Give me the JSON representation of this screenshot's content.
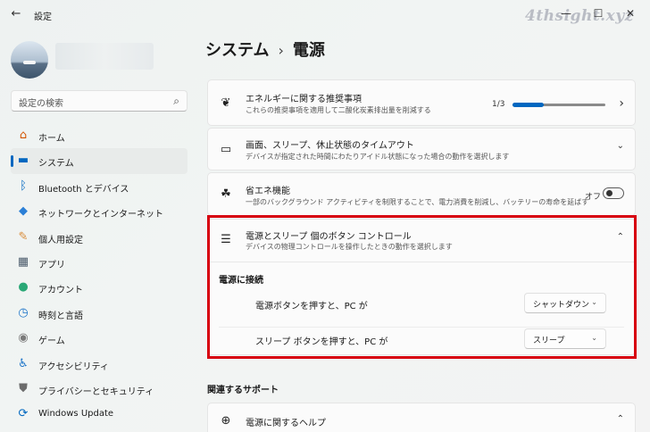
{
  "window": {
    "title": "設定",
    "back_glyph": "←",
    "minimize_glyph": "—",
    "maximize_glyph": "☐",
    "close_glyph": "✕",
    "watermark": "4thsight.xyz"
  },
  "search": {
    "placeholder": "設定の検索",
    "icon": "⌕"
  },
  "sidebar": {
    "items": [
      {
        "label": "ホーム",
        "icon": "home-icon",
        "glyph": "⌂",
        "color": "#d35400"
      },
      {
        "label": "システム",
        "icon": "system-icon",
        "glyph": "▬",
        "color": "#0067c0",
        "active": true
      },
      {
        "label": "Bluetooth とデバイス",
        "icon": "bluetooth-icon",
        "glyph": "ᛒ",
        "color": "#0067c0"
      },
      {
        "label": "ネットワークとインターネット",
        "icon": "network-icon",
        "glyph": "◆",
        "color": "#2b7fd6"
      },
      {
        "label": "個人用設定",
        "icon": "brush-icon",
        "glyph": "✎",
        "color": "#d98c3a"
      },
      {
        "label": "アプリ",
        "icon": "apps-icon",
        "glyph": "▦",
        "color": "#4a5a6a"
      },
      {
        "label": "アカウント",
        "icon": "account-icon",
        "glyph": "●",
        "color": "#2aa876"
      },
      {
        "label": "時刻と言語",
        "icon": "time-language-icon",
        "glyph": "◷",
        "color": "#1a73c8"
      },
      {
        "label": "ゲーム",
        "icon": "game-icon",
        "glyph": "◉",
        "color": "#7a7a7a"
      },
      {
        "label": "アクセシビリティ",
        "icon": "accessibility-icon",
        "glyph": "♿",
        "color": "#1a73c8"
      },
      {
        "label": "プライバシーとセキュリティ",
        "icon": "shield-icon",
        "glyph": "⛊",
        "color": "#6b6b6b"
      },
      {
        "label": "Windows Update",
        "icon": "windows-update-icon",
        "glyph": "⟳",
        "color": "#0067c0"
      }
    ]
  },
  "breadcrumb": {
    "parent": "システム",
    "separator": "›",
    "current": "電源"
  },
  "cards": {
    "energy_recommendations": {
      "icon": "leaf-icon",
      "glyph": "❦",
      "title": "エネルギーに関する推奨事項",
      "subtitle": "これらの推奨事項を適用して二酸化炭素排出量を削減する",
      "progress_text": "1/3",
      "progress_fraction": 0.333,
      "chevron": "›"
    },
    "screen_sleep": {
      "icon": "screen-sleep-icon",
      "glyph": "▭",
      "title": "画面、スリープ、休止状態のタイムアウト",
      "subtitle": "デバイスが指定された時間にわたりアイドル状態になった場合の動作を選択します",
      "chevron": "⌄"
    },
    "energy_saver": {
      "icon": "energy-saver-icon",
      "glyph": "☘",
      "title": "省エネ機能",
      "subtitle": "一部のバックグラウンド アクティビティを制限することで、電力消費を削減し、バッテリーの寿命を延ばす",
      "state": "オフ",
      "toggle_on": false
    },
    "power_buttons": {
      "icon": "power-button-list-icon",
      "glyph": "☰",
      "title": "電源とスリープ 個のボタン コントロール",
      "subtitle": "デバイスの物理コントロールを操作したときの動作を選択します",
      "chevron": "⌃",
      "section_label": "電源に接続",
      "rows": [
        {
          "label": "電源ボタンを押すと、PC が",
          "value": "シャットダウン"
        },
        {
          "label": "スリープ ボタンを押すと、PC が",
          "value": "スリープ"
        }
      ],
      "dropdown_chevron": "⌄"
    }
  },
  "related": {
    "heading": "関連するサポート",
    "help_card": {
      "icon": "globe-icon",
      "glyph": "⊕",
      "title": "電源に関するヘルプ",
      "chevron": "⌃"
    }
  },
  "colors": {
    "accent": "#0067c0",
    "highlight_border": "#d7000f"
  }
}
